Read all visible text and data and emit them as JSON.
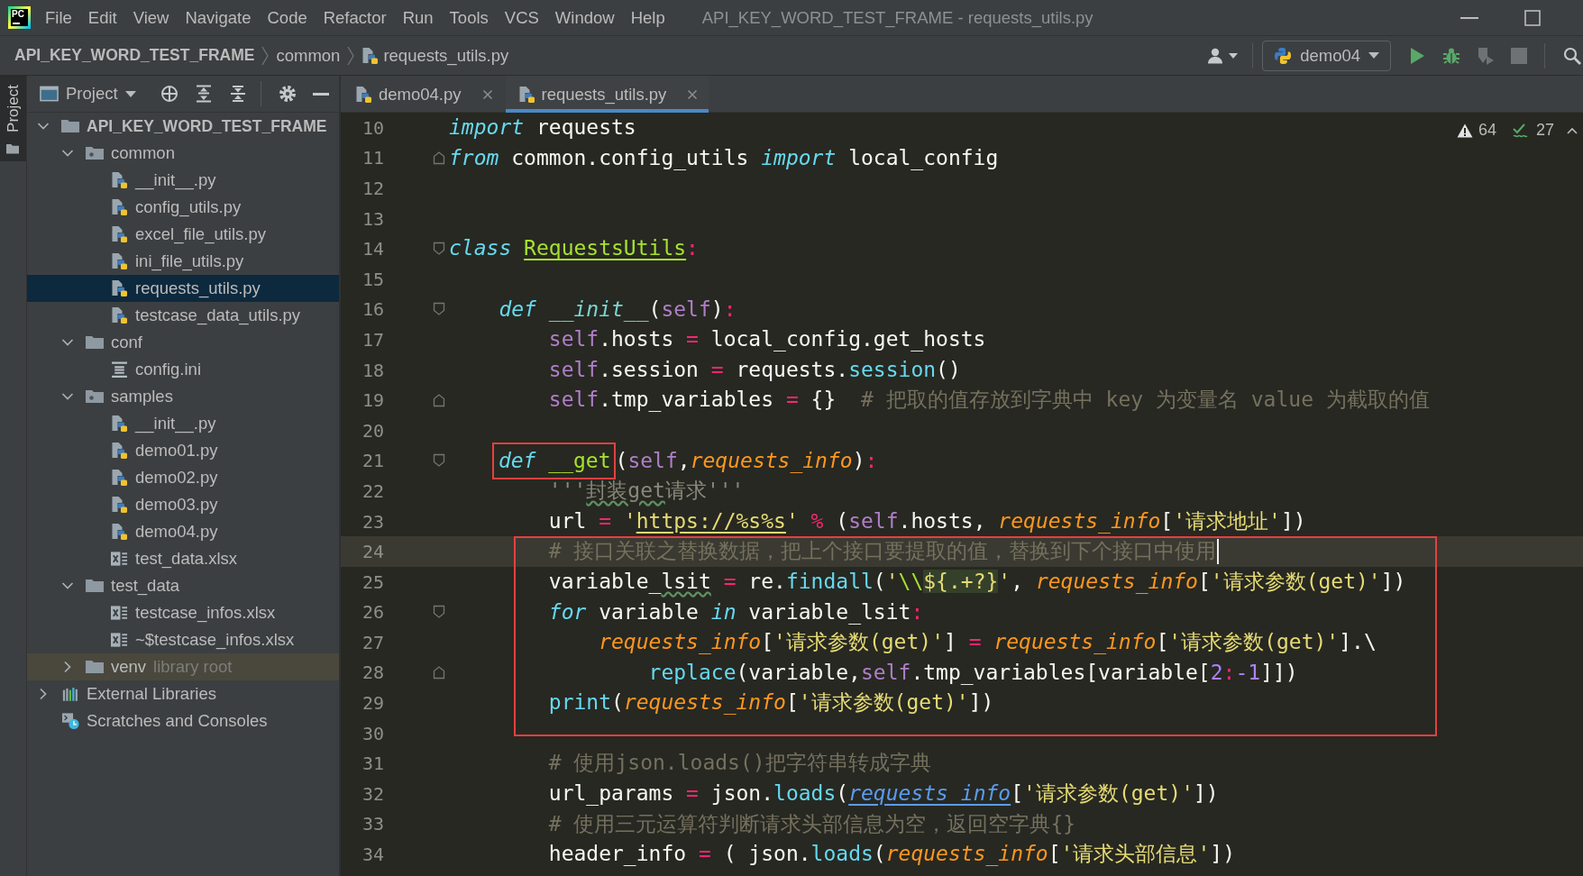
{
  "window": {
    "logo": "PC",
    "title": "API_KEY_WORD_TEST_FRAME - requests_utils.py"
  },
  "menu": [
    "File",
    "Edit",
    "View",
    "Navigate",
    "Code",
    "Refactor",
    "Run",
    "Tools",
    "VCS",
    "Window",
    "Help"
  ],
  "navigation_bar": {
    "breadcrumbs": [
      {
        "label": "API_KEY_WORD_TEST_FRAME",
        "kind": "project"
      },
      {
        "label": "common",
        "kind": "folder"
      },
      {
        "label": "requests_utils.py",
        "kind": "python"
      }
    ],
    "run_configuration": "demo04"
  },
  "tool_window_bar": [
    {
      "label": "Project",
      "selected": true
    }
  ],
  "project_panel": {
    "title": "Project",
    "tree": [
      {
        "label": "API_KEY_WORD_TEST_FRAME",
        "kind": "root",
        "expanded": true,
        "selected": false,
        "children": [
          {
            "label": "common",
            "kind": "package",
            "expanded": true,
            "selected": false,
            "children": [
              {
                "label": "__init__.py",
                "kind": "python",
                "selected": false
              },
              {
                "label": "config_utils.py",
                "kind": "python",
                "selected": false
              },
              {
                "label": "excel_file_utils.py",
                "kind": "python",
                "selected": false
              },
              {
                "label": "ini_file_utils.py",
                "kind": "python",
                "selected": false
              },
              {
                "label": "requests_utils.py",
                "kind": "python",
                "selected": true
              },
              {
                "label": "testcase_data_utils.py",
                "kind": "python",
                "selected": false
              }
            ]
          },
          {
            "label": "conf",
            "kind": "folder",
            "expanded": true,
            "selected": false,
            "children": [
              {
                "label": "config.ini",
                "kind": "ini",
                "selected": false
              }
            ]
          },
          {
            "label": "samples",
            "kind": "package",
            "expanded": true,
            "selected": false,
            "children": [
              {
                "label": "__init__.py",
                "kind": "python",
                "selected": false
              },
              {
                "label": "demo01.py",
                "kind": "python",
                "selected": false
              },
              {
                "label": "demo02.py",
                "kind": "python",
                "selected": false
              },
              {
                "label": "demo03.py",
                "kind": "python",
                "selected": false
              },
              {
                "label": "demo04.py",
                "kind": "python",
                "selected": false
              },
              {
                "label": "test_data.xlsx",
                "kind": "excel",
                "selected": false
              }
            ]
          },
          {
            "label": "test_data",
            "kind": "folder",
            "expanded": true,
            "selected": false,
            "children": [
              {
                "label": "testcase_infos.xlsx",
                "kind": "excel",
                "selected": false
              },
              {
                "label": "~$testcase_infos.xlsx",
                "kind": "excel",
                "selected": false
              }
            ]
          },
          {
            "label": "venv",
            "kind": "library_folder",
            "note": "library root",
            "expanded": false,
            "selected": false
          }
        ]
      },
      {
        "label": "External Libraries",
        "kind": "libraries",
        "expanded": false,
        "selected": false
      },
      {
        "label": "Scratches and Consoles",
        "kind": "scratches",
        "selected": false
      }
    ]
  },
  "editor_tabs": [
    {
      "label": "demo04.py",
      "selected": false
    },
    {
      "label": "requests_utils.py",
      "selected": true
    }
  ],
  "inspection_widget": {
    "warnings": "64",
    "weak_warnings": "27"
  },
  "editor": {
    "segments": [
      {
        "boxed": false,
        "lines": [
          {
            "number": "10",
            "kind": "line",
            "current": false,
            "tokens": [
              {
                "text": "import",
                "kind": "keyword"
              },
              {
                "text": " requests",
                "kind": "plain"
              }
            ]
          },
          {
            "number": "11",
            "kind": "block_end",
            "current": false,
            "tokens": [
              {
                "text": "from",
                "kind": "keyword"
              },
              {
                "text": " common.config_utils ",
                "kind": "plain"
              },
              {
                "text": "import",
                "kind": "keyword"
              },
              {
                "text": " local_config",
                "kind": "plain"
              }
            ]
          },
          {
            "number": "12",
            "kind": "line",
            "current": false
          },
          {
            "number": "13",
            "kind": "line",
            "current": false
          },
          {
            "number": "14",
            "kind": "block_start",
            "current": false,
            "tokens": [
              {
                "text": "class ",
                "kind": "keyword"
              },
              {
                "text": "RequestsUtils",
                "kind": "class_name"
              },
              {
                "text": ":",
                "kind": "op"
              }
            ]
          },
          {
            "number": "15",
            "kind": "line",
            "current": false
          },
          {
            "number": "16",
            "kind": "block_start",
            "current": false,
            "tokens": [
              {
                "text": "    def ",
                "kind": "keyword"
              },
              {
                "text": "__init__",
                "kind": "magic_method"
              },
              {
                "text": "(",
                "kind": "plain"
              },
              {
                "text": "self",
                "kind": "self"
              },
              {
                "text": ")",
                "kind": "plain"
              },
              {
                "text": ":",
                "kind": "op"
              }
            ]
          },
          {
            "number": "17",
            "kind": "line",
            "current": false,
            "tokens": [
              {
                "text": "        self",
                "kind": "self"
              },
              {
                "text": ".hosts ",
                "kind": "plain"
              },
              {
                "text": "=",
                "kind": "op"
              },
              {
                "text": " local_config.get_hosts",
                "kind": "plain"
              }
            ]
          },
          {
            "number": "18",
            "kind": "line",
            "current": false,
            "tokens": [
              {
                "text": "        self",
                "kind": "self"
              },
              {
                "text": ".session ",
                "kind": "plain"
              },
              {
                "text": "=",
                "kind": "op"
              },
              {
                "text": " requests.",
                "kind": "plain"
              },
              {
                "text": "session",
                "kind": "call"
              },
              {
                "text": "()",
                "kind": "plain"
              }
            ]
          },
          {
            "number": "19",
            "kind": "block_end",
            "current": false,
            "tokens": [
              {
                "text": "        self",
                "kind": "self"
              },
              {
                "text": ".tmp_variables ",
                "kind": "plain"
              },
              {
                "text": "=",
                "kind": "op"
              },
              {
                "text": " {}  ",
                "kind": "plain"
              },
              {
                "text": "# 把取的值存放到字典中 key 为变量名 value 为截取的值",
                "kind": "comment"
              }
            ]
          },
          {
            "number": "20",
            "kind": "line",
            "current": false
          },
          {
            "number": "21",
            "kind": "block_start",
            "current": false,
            "boxed_tokens": [
              {
                "text": "    def ",
                "kind": "keyword"
              },
              {
                "text": "__get",
                "kind": "func_name"
              }
            ],
            "tokens": [
              {
                "text": "(",
                "kind": "plain"
              },
              {
                "text": "self",
                "kind": "self"
              },
              {
                "text": ",",
                "kind": "plain"
              },
              {
                "text": "requests_info",
                "kind": "param"
              },
              {
                "text": ")",
                "kind": "plain"
              },
              {
                "text": ":",
                "kind": "op"
              }
            ]
          },
          {
            "number": "22",
            "kind": "line",
            "current": false,
            "tokens": [
              {
                "text": "        '''",
                "kind": "docstring"
              },
              {
                "text": "封装get",
                "kind": "docstring_typo"
              },
              {
                "text": "请求'''",
                "kind": "docstring"
              }
            ]
          },
          {
            "number": "23",
            "kind": "line",
            "current": false,
            "tokens": [
              {
                "text": "        url ",
                "kind": "plain"
              },
              {
                "text": "=",
                "kind": "op"
              },
              {
                "text": " '",
                "kind": "string"
              },
              {
                "text": "https://%s%s",
                "kind": "string_link"
              },
              {
                "text": "' ",
                "kind": "string"
              },
              {
                "text": "%",
                "kind": "op"
              },
              {
                "text": " (",
                "kind": "plain"
              },
              {
                "text": "self",
                "kind": "self"
              },
              {
                "text": ".hosts, ",
                "kind": "plain"
              },
              {
                "text": "requests_info",
                "kind": "param"
              },
              {
                "text": "[",
                "kind": "plain"
              },
              {
                "text": "'请求地址'",
                "kind": "string"
              },
              {
                "text": "])",
                "kind": "plain"
              }
            ]
          }
        ]
      },
      {
        "boxed": true,
        "lines": [
          {
            "number": "24",
            "kind": "line",
            "current": true,
            "tokens": [
              {
                "text": "        # 接口关联之替换数据，把上个接口要提取的值，替换到下个接口中使用",
                "kind": "comment"
              }
            ]
          },
          {
            "number": "25",
            "kind": "line",
            "current": false,
            "tokens": [
              {
                "text": "        variable_",
                "kind": "plain"
              },
              {
                "text": "lsit",
                "kind": "typo"
              },
              {
                "text": " = ",
                "kind": "op"
              },
              {
                "text": "re.",
                "kind": "plain"
              },
              {
                "text": "findall",
                "kind": "call"
              },
              {
                "text": "(",
                "kind": "plain"
              },
              {
                "text": "'",
                "kind": "string"
              },
              {
                "text": "\\\\",
                "kind": "escape"
              },
              {
                "text": "${.+?}",
                "kind": "regex"
              },
              {
                "text": "'",
                "kind": "string"
              },
              {
                "text": ", ",
                "kind": "plain"
              },
              {
                "text": "requests_info",
                "kind": "param"
              },
              {
                "text": "[",
                "kind": "plain"
              },
              {
                "text": "'请求参数(get)'",
                "kind": "string"
              },
              {
                "text": "])",
                "kind": "plain"
              }
            ]
          },
          {
            "number": "26",
            "kind": "block_start",
            "current": false,
            "tokens": [
              {
                "text": "        for",
                "kind": "keyword"
              },
              {
                "text": " variable ",
                "kind": "plain"
              },
              {
                "text": "in",
                "kind": "keyword"
              },
              {
                "text": " variable_lsit",
                "kind": "plain"
              },
              {
                "text": ":",
                "kind": "op"
              }
            ]
          },
          {
            "number": "27",
            "kind": "line",
            "current": false,
            "tokens": [
              {
                "text": "            requests_info",
                "kind": "param"
              },
              {
                "text": "[",
                "kind": "plain"
              },
              {
                "text": "'请求参数(get)'",
                "kind": "string"
              },
              {
                "text": "] ",
                "kind": "plain"
              },
              {
                "text": "=",
                "kind": "op"
              },
              {
                "text": " requests_info",
                "kind": "param"
              },
              {
                "text": "[",
                "kind": "plain"
              },
              {
                "text": "'请求参数(get)'",
                "kind": "string"
              },
              {
                "text": "].\\",
                "kind": "plain"
              }
            ]
          },
          {
            "number": "28",
            "kind": "block_end",
            "current": false,
            "tokens": [
              {
                "text": "                replace",
                "kind": "call"
              },
              {
                "text": "(variable,",
                "kind": "plain"
              },
              {
                "text": "self",
                "kind": "self"
              },
              {
                "text": ".tmp_variables[variable[",
                "kind": "plain"
              },
              {
                "text": "2",
                "kind": "number"
              },
              {
                "text": ":",
                "kind": "op"
              },
              {
                "text": "-1",
                "kind": "number"
              },
              {
                "text": "]])",
                "kind": "plain"
              }
            ]
          },
          {
            "number": "29",
            "kind": "line",
            "current": false,
            "tokens": [
              {
                "text": "        print",
                "kind": "call"
              },
              {
                "text": "(",
                "kind": "plain"
              },
              {
                "text": "requests_info",
                "kind": "param"
              },
              {
                "text": "[",
                "kind": "plain"
              },
              {
                "text": "'请求参数(get)'",
                "kind": "string"
              },
              {
                "text": "])",
                "kind": "plain"
              }
            ]
          }
        ]
      },
      {
        "boxed": false,
        "lines": [
          {
            "number": "30",
            "kind": "line",
            "current": false
          },
          {
            "number": "31",
            "kind": "line",
            "current": false,
            "tokens": [
              {
                "text": "        # 使用json.loads()把字符串转成字典",
                "kind": "comment"
              }
            ]
          },
          {
            "number": "32",
            "kind": "line",
            "current": false,
            "tokens": [
              {
                "text": "        url_params ",
                "kind": "plain"
              },
              {
                "text": "=",
                "kind": "op"
              },
              {
                "text": " json.",
                "kind": "plain"
              },
              {
                "text": "loads",
                "kind": "call"
              },
              {
                "text": "(",
                "kind": "plain"
              },
              {
                "text": "requests_info",
                "kind": "param_link"
              },
              {
                "text": "[",
                "kind": "plain"
              },
              {
                "text": "'请求参数(get)'",
                "kind": "string"
              },
              {
                "text": "])",
                "kind": "plain"
              }
            ]
          },
          {
            "number": "33",
            "kind": "line",
            "current": false,
            "tokens": [
              {
                "text": "        # 使用三元运算符判断请求头部信息为空，返回空字典{}",
                "kind": "comment"
              }
            ]
          },
          {
            "number": "34",
            "kind": "line",
            "current": false,
            "tokens": [
              {
                "text": "        header_info ",
                "kind": "plain"
              },
              {
                "text": "=",
                "kind": "op"
              },
              {
                "text": " ( json.",
                "kind": "plain"
              },
              {
                "text": "loads",
                "kind": "call"
              },
              {
                "text": "(",
                "kind": "plain"
              },
              {
                "text": "requests_info",
                "kind": "param"
              },
              {
                "text": "[",
                "kind": "plain"
              },
              {
                "text": "'请求头部信息'",
                "kind": "string"
              },
              {
                "text": "])",
                "kind": "plain"
              }
            ]
          }
        ]
      }
    ]
  }
}
